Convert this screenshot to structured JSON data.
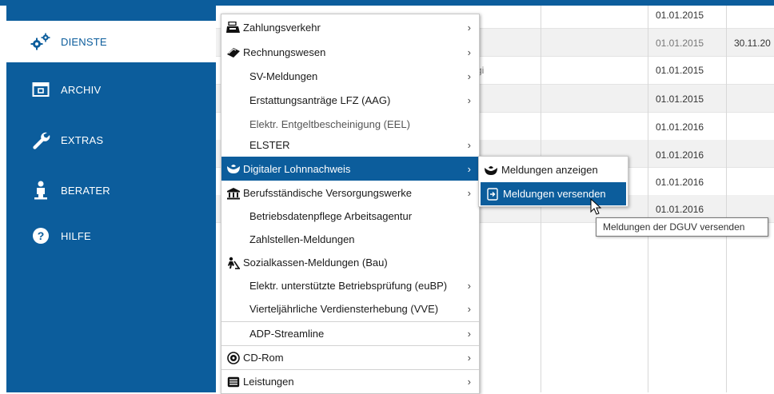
{
  "sidebar": {
    "items": [
      {
        "label": "DIENSTE",
        "icon": "gears-icon",
        "active": true
      },
      {
        "label": "ARCHIV",
        "icon": "archive-box-icon"
      },
      {
        "label": "EXTRAS",
        "icon": "wrench-icon"
      },
      {
        "label": "BERATER",
        "icon": "person-icon"
      },
      {
        "label": "HILFE",
        "icon": "help-circle-icon"
      }
    ]
  },
  "table": {
    "rows": [
      {
        "date": "01.01.2015",
        "date2": "",
        "frag": ""
      },
      {
        "date": "01.01.2015",
        "date2": "30.11.20",
        "frag": ""
      },
      {
        "date": "01.01.2015",
        "date2": "",
        "frag": "gi"
      },
      {
        "date": "01.01.2015",
        "date2": "",
        "frag": ""
      },
      {
        "date": "01.01.2016",
        "date2": "",
        "frag": ""
      },
      {
        "date": "01.01.2016",
        "date2": "",
        "frag": ""
      },
      {
        "date": "01.01.2016",
        "date2": "",
        "frag": ""
      },
      {
        "date": "01.01.2016",
        "date2": "",
        "frag": ""
      }
    ]
  },
  "menu": {
    "items": [
      {
        "label": "Zahlungsverkehr",
        "icon": "cash-register-icon",
        "submenu": true
      },
      {
        "label": "Rechnungswesen",
        "icon": "eraser-icon",
        "submenu": true
      },
      {
        "label": "SV-Meldungen",
        "icon": "",
        "submenu": true
      },
      {
        "label": "Erstattungsanträge LFZ (AAG)",
        "icon": "",
        "submenu": true
      },
      {
        "label": "Elektr. Entgeltbescheinigung (EEL)",
        "icon": "",
        "submenu": false
      },
      {
        "label": "ELSTER",
        "icon": "",
        "submenu": true
      },
      {
        "label": "Digitaler Lohnnachweis",
        "icon": "helmet-icon",
        "submenu": true,
        "highlighted": true
      },
      {
        "label": "Berufsständische Versorgungswerke",
        "icon": "institution-icon",
        "submenu": true
      },
      {
        "label": "Betriebsdatenpflege Arbeitsagentur",
        "icon": "",
        "submenu": false
      },
      {
        "label": "Zahlstellen-Meldungen",
        "icon": "",
        "submenu": false
      },
      {
        "label": "Sozialkassen-Meldungen (Bau)",
        "icon": "construction-worker-icon",
        "submenu": false
      },
      {
        "label": "Elektr. unterstützte Betriebsprüfung (euBP)",
        "icon": "",
        "submenu": true
      },
      {
        "label": "Vierteljährliche Verdiensterhebung (VVE)",
        "icon": "",
        "submenu": true
      },
      {
        "label": "ADP-Streamline",
        "icon": "",
        "submenu": true
      },
      {
        "label": "CD-Rom",
        "icon": "cd-rom-icon",
        "submenu": true
      },
      {
        "label": "Leistungen",
        "icon": "list-icon",
        "submenu": true
      }
    ],
    "arrow": "›"
  },
  "submenu": {
    "items": [
      {
        "label": "Meldungen anzeigen",
        "icon": "helmet-icon"
      },
      {
        "label": "Meldungen versenden",
        "icon": "send-file-icon",
        "highlighted": true
      }
    ]
  },
  "tooltip": {
    "text": "Meldungen der DGUV versenden"
  },
  "colors": {
    "primary": "#0c5d9c",
    "menu_bg": "#ffffff",
    "row_alt": "#f1f1f1"
  }
}
